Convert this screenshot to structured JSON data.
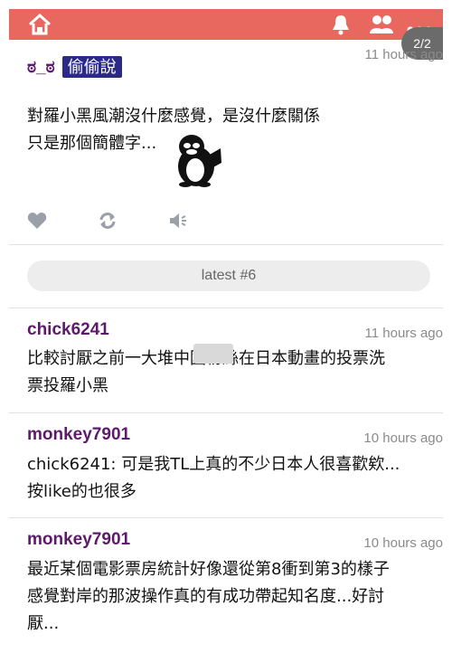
{
  "page_indicator": "2/2",
  "topbar": {
    "color": "#e8685f",
    "icons": [
      "home-icon",
      "bell-icon",
      "users-icon",
      "more-icon"
    ]
  },
  "first_post": {
    "username": "ಠ_ಠ",
    "tag": "偷偷說",
    "time": "11 hours ago",
    "lines": [
      "對羅小黑風潮沒什麼感覺，是沒什麼關係",
      "只是那個簡體字..."
    ],
    "actions": [
      "heart-icon",
      "repost-icon",
      "speaker-icon"
    ]
  },
  "latest_label": "latest #6",
  "comments": [
    {
      "username": "chick6241",
      "time": "11 hours ago",
      "lines": [
        "比較討厭之前一大堆中國粉絲在日本動畫的投票洗",
        "票投羅小黑"
      ]
    },
    {
      "username": "monkey7901",
      "time": "10 hours ago",
      "lines": [
        "chick6241: 可是我TL上真的不少日本人很喜歡欸...",
        "按like的也很多"
      ]
    },
    {
      "username": "monkey7901",
      "time": "10 hours ago",
      "lines": [
        "最近某個電影票房統計好像還從第8衝到第3的樣子",
        "感覺對岸的那波操作真的有成功帶起知名度...好討",
        "厭..."
      ]
    }
  ]
}
